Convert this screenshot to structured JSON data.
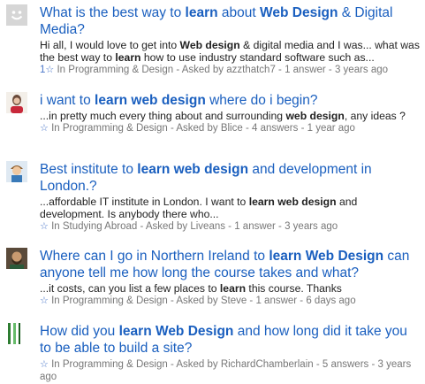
{
  "results": [
    {
      "title_parts": [
        {
          "t": "What is the best way to ",
          "b": false
        },
        {
          "t": "learn",
          "b": true
        },
        {
          "t": " about ",
          "b": false
        },
        {
          "t": "Web Design",
          "b": true
        },
        {
          "t": " & Digital Media?",
          "b": false
        }
      ],
      "snippet_parts": [
        {
          "t": "Hi all, I would love to get into ",
          "b": false
        },
        {
          "t": "Web design",
          "b": true
        },
        {
          "t": " & digital media and I was... what was the best way to ",
          "b": false
        },
        {
          "t": "learn",
          "b": true
        },
        {
          "t": " how to use industry standard software such as...",
          "b": false
        }
      ],
      "star_count": "1",
      "meta": "In Programming & Design - Asked by azzthatch7 - 1 answer - 3 years ago",
      "avatar": "default-avatar-icon"
    },
    {
      "title_parts": [
        {
          "t": "i want to ",
          "b": false
        },
        {
          "t": "learn web design",
          "b": true
        },
        {
          "t": " where do i begin?",
          "b": false
        }
      ],
      "snippet_parts": [
        {
          "t": "...in pretty much every thing about and surrounding ",
          "b": false
        },
        {
          "t": "web design",
          "b": true
        },
        {
          "t": ", any ideas ?",
          "b": false
        }
      ],
      "star_count": "",
      "meta": "In Programming & Design - Asked by Blice - 4 answers - 1 year ago",
      "avatar": "red-shirt-avatar"
    },
    {
      "title_parts": [
        {
          "t": "Best institute to ",
          "b": false
        },
        {
          "t": "learn web design",
          "b": true
        },
        {
          "t": " and development in London.?",
          "b": false
        }
      ],
      "snippet_parts": [
        {
          "t": "...affordable IT institute in London. I want to ",
          "b": false
        },
        {
          "t": "learn web design",
          "b": true
        },
        {
          "t": " and development. Is anybody there who...",
          "b": false
        }
      ],
      "star_count": "",
      "meta": "In Studying Abroad - Asked by Liveans - 1 answer - 3 years ago",
      "avatar": "cartoon-boy-avatar"
    },
    {
      "title_parts": [
        {
          "t": "Where can I go in Northern Ireland to ",
          "b": false
        },
        {
          "t": "learn Web Design",
          "b": true
        },
        {
          "t": " can anyone tell me how long the course takes and what?",
          "b": false
        }
      ],
      "snippet_parts": [
        {
          "t": "...it costs, can you list a few places to ",
          "b": false
        },
        {
          "t": "learn",
          "b": true
        },
        {
          "t": " this course. Thanks",
          "b": false
        }
      ],
      "star_count": "",
      "meta": "In Programming & Design - Asked by Steve - 1 answer - 6 days ago",
      "avatar": "bearded-man-avatar"
    },
    {
      "title_parts": [
        {
          "t": "How did you ",
          "b": false
        },
        {
          "t": "learn Web Design",
          "b": true
        },
        {
          "t": " and how long did it take you to be able to build a site?",
          "b": false
        }
      ],
      "snippet_parts": [],
      "star_count": "",
      "meta": "In Programming & Design - Asked by RichardChamberlain - 5 answers - 3 years ago",
      "avatar": "striped-avatar"
    }
  ]
}
